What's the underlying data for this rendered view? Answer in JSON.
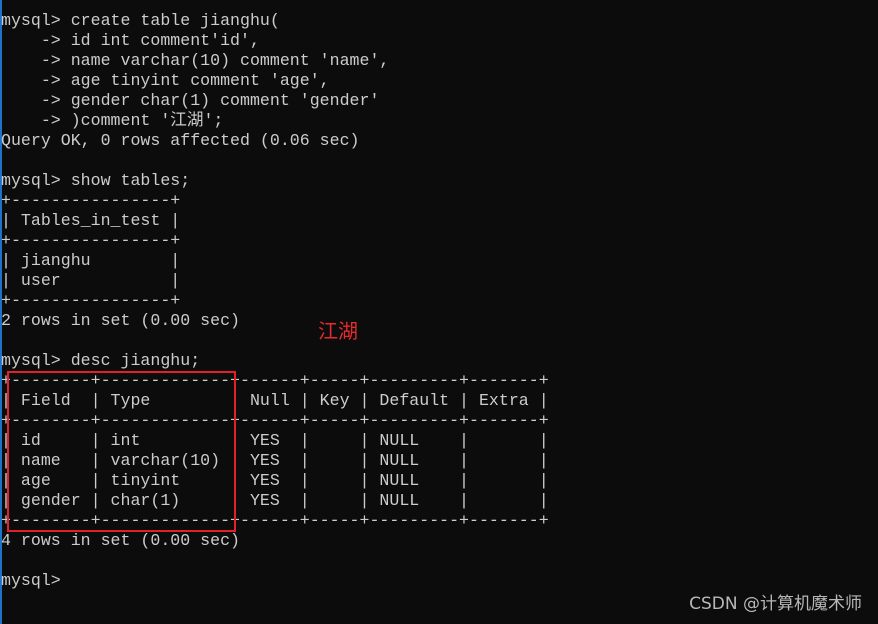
{
  "terminal": {
    "lines": [
      "mysql> create table jianghu(",
      "    -> id int comment'id',",
      "    -> name varchar(10) comment 'name',",
      "    -> age tinyint comment 'age',",
      "    -> gender char(1) comment 'gender'",
      "    -> )comment '江湖';",
      "Query OK, 0 rows affected (0.06 sec)",
      "",
      "mysql> show tables;",
      "+----------------+",
      "| Tables_in_test |",
      "+----------------+",
      "| jianghu        |",
      "| user           |",
      "+----------------+",
      "2 rows in set (0.00 sec)",
      "",
      "mysql> desc jianghu;",
      "+--------+-------------+------+-----+---------+-------+",
      "| Field  | Type        | Null | Key | Default | Extra |",
      "+--------+-------------+------+-----+---------+-------+",
      "| id     | int         | YES  |     | NULL    |       |",
      "| name   | varchar(10) | YES  |     | NULL    |       |",
      "| age    | tinyint     | YES  |     | NULL    |       |",
      "| gender | char(1)     | YES  |     | NULL    |       |",
      "+--------+-------------+------+-----+---------+-------+",
      "4 rows in set (0.00 sec)",
      "",
      "mysql> "
    ]
  },
  "annotation": {
    "text": "江湖",
    "color": "#e52b2b"
  },
  "highlight": {
    "color": "#e3202a",
    "target": "Field and Type columns"
  },
  "watermark": {
    "text": "CSDN @计算机魔术师"
  }
}
